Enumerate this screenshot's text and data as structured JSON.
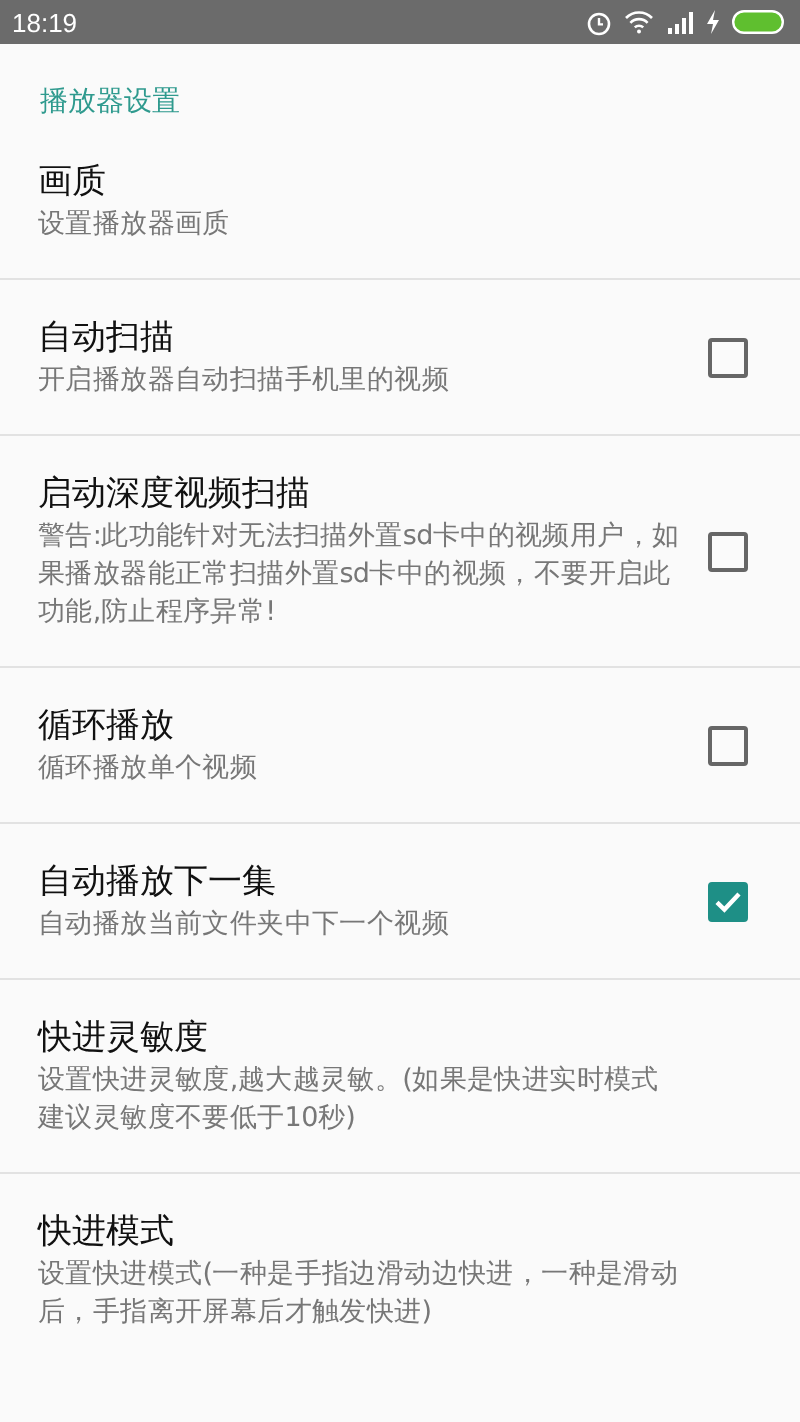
{
  "status_bar": {
    "time": "18:19"
  },
  "section_title": "播放器设置",
  "settings": [
    {
      "kind": "text",
      "title": "画质",
      "summary": "设置播放器画质"
    },
    {
      "kind": "checkbox",
      "title": "自动扫描",
      "summary": "开启播放器自动扫描手机里的视频",
      "checked": false
    },
    {
      "kind": "checkbox",
      "title": "启动深度视频扫描",
      "summary": "警告:此功能针对无法扫描外置sd卡中的视频用户，如果播放器能正常扫描外置sd卡中的视频，不要开启此功能,防止程序异常!",
      "checked": false
    },
    {
      "kind": "checkbox",
      "title": "循环播放",
      "summary": "循环播放单个视频",
      "checked": false
    },
    {
      "kind": "checkbox",
      "title": "自动播放下一集",
      "summary": "自动播放当前文件夹中下一个视频",
      "checked": true
    },
    {
      "kind": "text",
      "title": "快进灵敏度",
      "summary": "设置快进灵敏度,越大越灵敏。(如果是快进实时模式建议灵敏度不要低于10秒)"
    },
    {
      "kind": "text",
      "title": "快进模式",
      "summary": "设置快进模式(一种是手指边滑动边快进，一种是滑动后，手指离开屏幕后才触发快进)"
    }
  ]
}
